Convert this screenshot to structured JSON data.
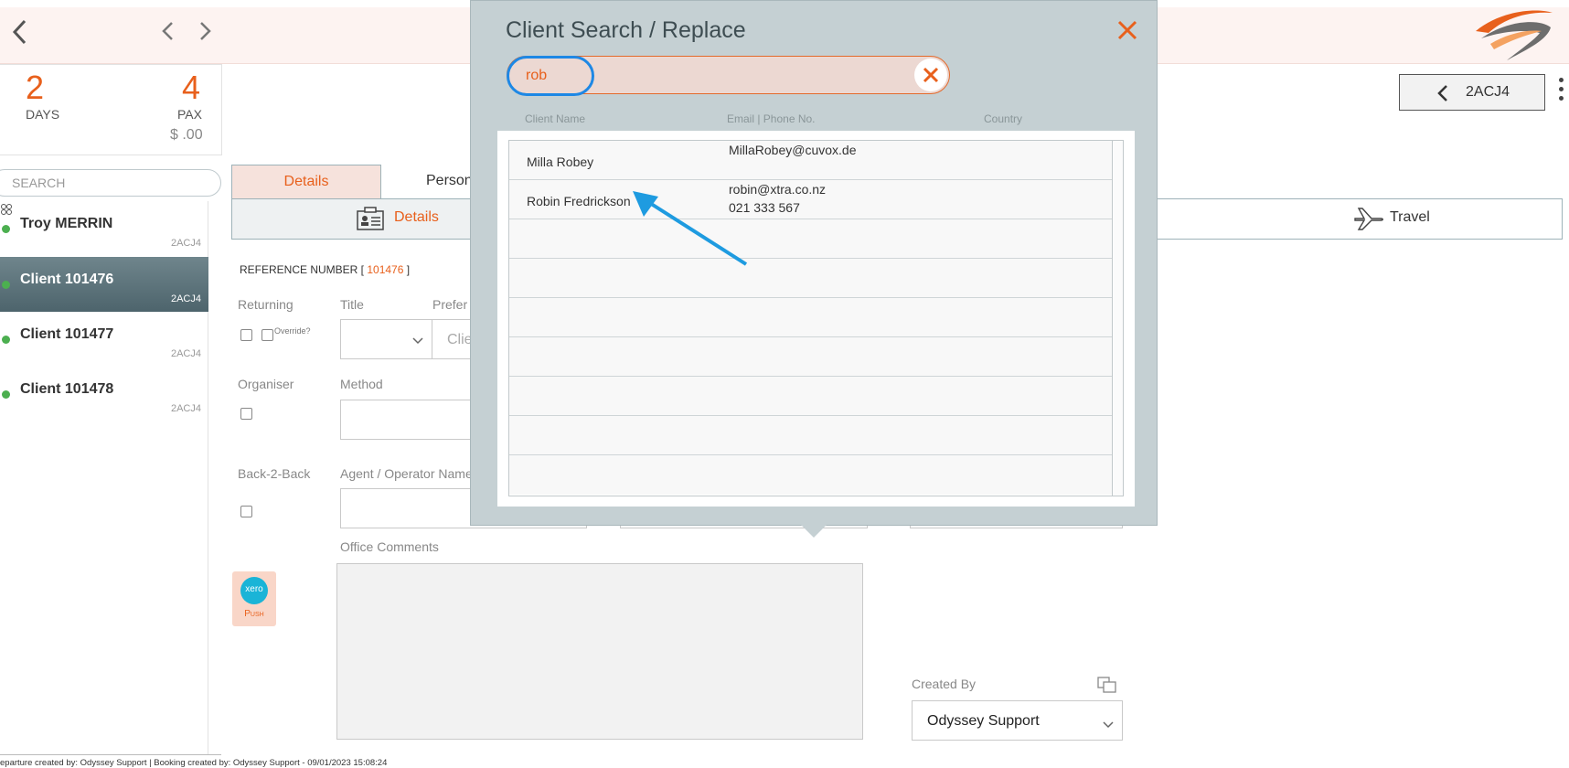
{
  "trip": {
    "days_value": "2",
    "days_label": "DAYS",
    "pax_value": "4",
    "pax_label": "PAX",
    "price": "$ .00"
  },
  "search": {
    "placeholder": "SEARCH"
  },
  "clients": [
    {
      "name": "Troy MERRIN",
      "code": "2ACJ4",
      "active": false
    },
    {
      "name": "Client 101476",
      "code": "2ACJ4",
      "active": true
    },
    {
      "name": "Client 101477",
      "code": "2ACJ4",
      "active": false
    },
    {
      "name": "Client 101478",
      "code": "2ACJ4",
      "active": false
    }
  ],
  "tabs": {
    "details": "Details",
    "personal": "Person"
  },
  "subtabs": {
    "details": "Details",
    "travel": "Travel"
  },
  "form": {
    "reference_prefix": "REFERENCE NUMBER [ ",
    "reference_number": "101476",
    "reference_suffix": " ]",
    "returning": "Returning",
    "override": "Override?",
    "title": "Title",
    "preferred": "Prefer",
    "client_placeholder": "Clie",
    "organiser": "Organiser",
    "method": "Method",
    "back2back": "Back-2-Back",
    "agent": "Agent / Operator Name",
    "office_comments": "Office Comments",
    "created_by_label": "Created By",
    "created_by_value": "Odyssey Support"
  },
  "xero": {
    "logo": "xero",
    "action": "Push"
  },
  "booking": {
    "pnr": "2ACJ4"
  },
  "modal": {
    "title": "Client Search / Replace",
    "search_value": "rob",
    "columns": [
      "Client Name",
      "Email | Phone No.",
      "Country"
    ],
    "results": [
      {
        "name": "Milla Robey",
        "contact": [
          "MillaRobey@cuvox.de"
        ],
        "country": ""
      },
      {
        "name": "Robin Fredrickson",
        "contact": [
          "robin@xtra.co.nz",
          "021 333 567"
        ],
        "country": ""
      }
    ]
  },
  "footer": {
    "text": "eparture created by: Odyssey Support | Booking created by: Odyssey Support - 09/01/2023 15:08:24"
  },
  "colors": {
    "accent": "#e8601c",
    "annotation_arrow": "#1e9be0",
    "active_item": "#5c7279"
  }
}
